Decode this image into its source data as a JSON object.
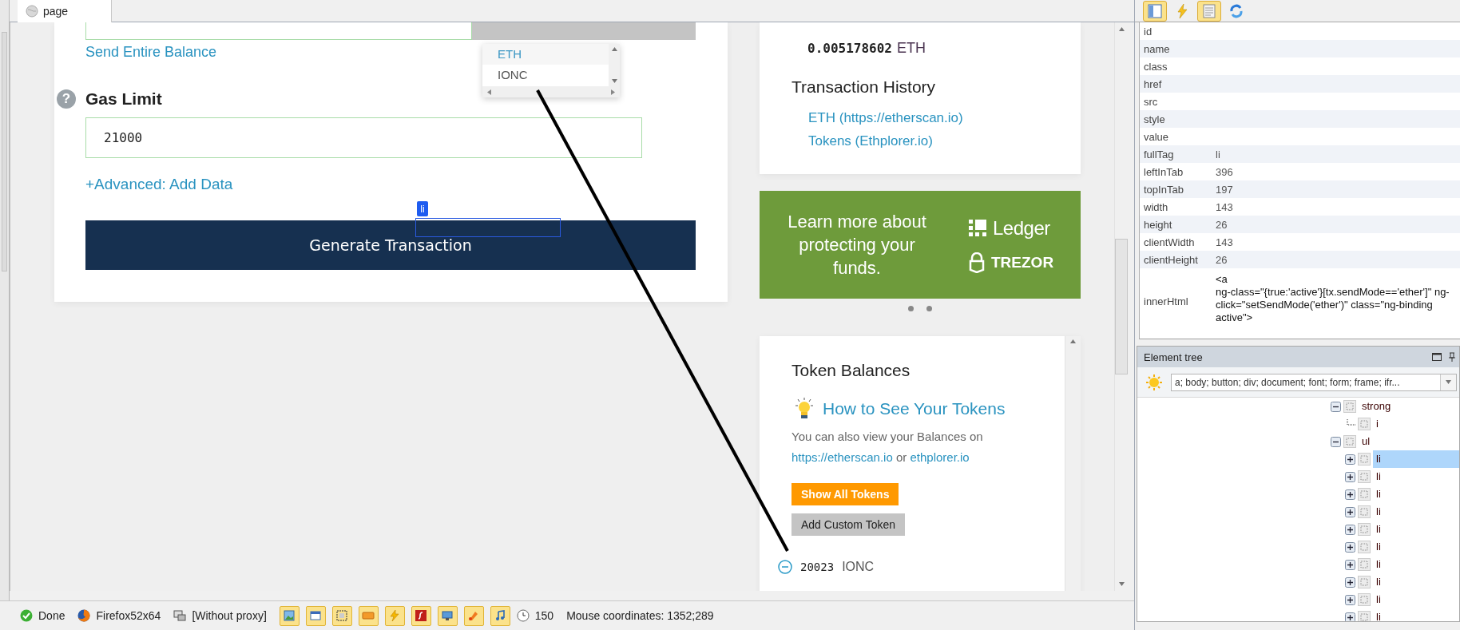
{
  "browser_tab": {
    "title": "page"
  },
  "send_form": {
    "send_entire_balance": "Send Entire Balance",
    "gas_limit": {
      "help": "?",
      "label": "Gas Limit",
      "value": "21000"
    },
    "advanced_link": "+Advanced: Add Data",
    "generate_button": "Generate Transaction"
  },
  "token_dropdown": {
    "options": [
      {
        "label": "ETH",
        "selected": true
      },
      {
        "label": "IONC",
        "selected": false
      }
    ]
  },
  "inspector_highlight": {
    "tag": "li"
  },
  "account": {
    "balance": "0.005178602",
    "unit": "ETH",
    "history_title": "Transaction History",
    "history_links": [
      "ETH (https://etherscan.io)",
      "Tokens (Ethplorer.io)"
    ]
  },
  "banner": {
    "text": "Learn more about protecting your funds.",
    "logos": [
      "Ledger",
      "TREZOR"
    ]
  },
  "tokens": {
    "title": "Token Balances",
    "help_link": "How to See Your Tokens",
    "note": "You can also view your Balances on",
    "note_links": [
      "https://etherscan.io",
      "ethplorer.io"
    ],
    "note_joiner": "or",
    "buttons": [
      {
        "kind": "primary",
        "label": "Show All Tokens"
      },
      {
        "kind": "secondary",
        "label": "Add Custom Token"
      }
    ],
    "items": [
      {
        "amount": "20023",
        "symbol": "IONC"
      }
    ]
  },
  "inspector": {
    "toolbar": [
      {
        "selected": true
      },
      {
        "selected": false
      },
      {
        "selected": true
      },
      {
        "selected": false
      }
    ],
    "properties": [
      {
        "name": "id"
      },
      {
        "name": "name"
      },
      {
        "name": "class"
      },
      {
        "name": "href"
      },
      {
        "name": "src"
      },
      {
        "name": "style"
      },
      {
        "name": "value"
      },
      {
        "name": "fullTag",
        "value": "li"
      },
      {
        "name": "leftInTab",
        "value": "396"
      },
      {
        "name": "topInTab",
        "value": "197"
      },
      {
        "name": "width",
        "value": "143"
      },
      {
        "name": "height",
        "value": "26"
      },
      {
        "name": "clientWidth",
        "value": "143"
      },
      {
        "name": "clientHeight",
        "value": "26"
      },
      {
        "name": "innerHtml",
        "value": "<a\nng-class=\"{true:'active'}[tx.sendMode=='ether']\" ng-click=\"setSendMode('ether')\" class=\"ng-binding active\">"
      }
    ]
  },
  "element_tree": {
    "title": "Element tree",
    "filter": "a; body; button; div; document; font; form; frame; ifr...",
    "nodes": [
      {
        "label": "strong",
        "expanded": true,
        "children": [
          {
            "label": "i"
          }
        ]
      },
      {
        "label": "ul",
        "expanded": true,
        "children": [
          {
            "label": "li",
            "expanded": false,
            "selected": true
          },
          {
            "label": "li",
            "expanded": false,
            "selected": false
          },
          {
            "label": "li",
            "expanded": false,
            "selected": false
          },
          {
            "label": "li",
            "expanded": false,
            "selected": false
          },
          {
            "label": "li",
            "expanded": false,
            "selected": false
          },
          {
            "label": "li",
            "expanded": false,
            "selected": false
          },
          {
            "label": "li",
            "expanded": false,
            "selected": false
          },
          {
            "label": "li",
            "expanded": false,
            "selected": false
          },
          {
            "label": "li",
            "expanded": false,
            "selected": false
          },
          {
            "label": "li",
            "expanded": false,
            "selected": false
          }
        ]
      }
    ]
  },
  "status_bar": {
    "items": [
      {
        "kind": "status",
        "text": "Done"
      },
      {
        "kind": "browser",
        "text": "Firefox52x64"
      },
      {
        "kind": "proxy",
        "text": "[Without proxy]"
      }
    ],
    "timer": "150",
    "mouse": "Mouse coordinates: 1352;289"
  }
}
